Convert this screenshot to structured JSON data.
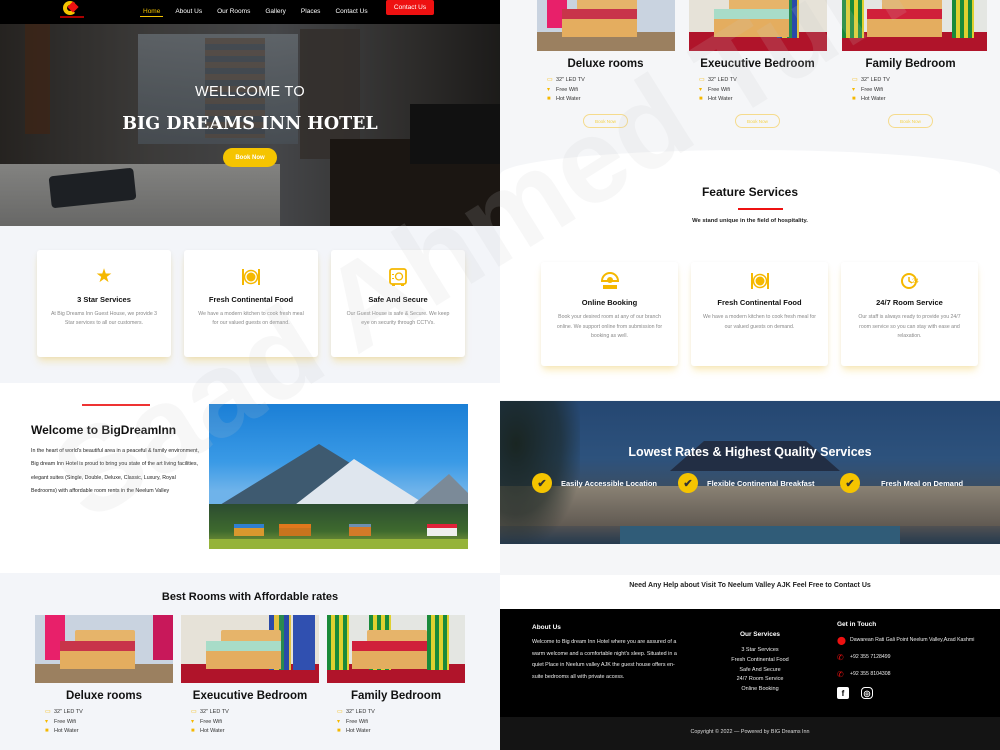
{
  "nav": {
    "links": [
      "Home",
      "About Us",
      "Our Rooms",
      "Gallery",
      "Places",
      "Contact Us"
    ],
    "active": "Home",
    "cta_label": "Contact Us"
  },
  "hero": {
    "welcome": "WELLCOME TO",
    "title": "BIG DREAMS INN HOTEL",
    "button": "Book Now"
  },
  "services": [
    {
      "icon": "star-icon",
      "title": "3 Star Services",
      "desc": "At Big Dreams Inn Guest House, we provide 3 Star services to all our customers."
    },
    {
      "icon": "plate-icon",
      "title": "Fresh Continental Food",
      "desc": "We have a modern kitchen to cook fresh meal for our valued guests on demand."
    },
    {
      "icon": "safe-icon",
      "title": "Safe And Secure",
      "desc": "Our Guest House is safe & Secure. We keep eye on security through CCTVs."
    }
  ],
  "welcome": {
    "title": "Welcome to BigDreamInn",
    "text": "In the heart of world's beautiful area in a peaceful & family environment, Big dream Inn Hotel is proud to bring you state of the art living facilities, elegant suites (Single, Double, Deluxe, Classic, Luxury, Royal Bedrooms) with affordable room rents in the Neelum Valley"
  },
  "rooms": {
    "title": "Best Rooms with Affordable rates",
    "items": [
      {
        "name": "Deluxe rooms",
        "features": [
          "32\" LED TV",
          "Free Wifi",
          "Hot Water"
        ],
        "button": "Book Now"
      },
      {
        "name": "Exeucutive Bedroom",
        "features": [
          "32\" LED TV",
          "Free Wifi",
          "Hot Water"
        ],
        "button": "Book Now"
      },
      {
        "name": "Family Bedroom",
        "features": [
          "32\" LED TV",
          "Free Wifi",
          "Hot Water"
        ],
        "button": "Book Now"
      }
    ]
  },
  "feature_services": {
    "title": "Feature Services",
    "subtitle": "We stand unique in the field of hospitality.",
    "items": [
      {
        "icon": "online-booking-icon",
        "title": "Online Booking",
        "desc": "Book your desired room at any of our branch online. We support online from submission for booking as well."
      },
      {
        "icon": "plate-icon",
        "title": "Fresh Continental Food",
        "desc": "We have a modern kitchen to cook fresh meal for our valued guests on demand."
      },
      {
        "icon": "clock-24-icon",
        "title": "24/7 Room Service",
        "desc": "Our staff is always ready to provide you 24/7 room service so you can stay with ease and relaxation."
      }
    ]
  },
  "lowest": {
    "title": "Lowest Rates & Highest Quality Services",
    "checks": [
      "Easily Accessible Location",
      "Flexible Continental Breakfast",
      "Fresh Meal on Demand"
    ]
  },
  "help": {
    "text": "Need Any Help about Visit To Neelum Valley AJK Feel Free to Contact Us"
  },
  "footer": {
    "about_title": "About Us",
    "about_text": "Welcome to Big dream Inn  Hotel where you are assured of a warm welcome and a comfortable night's sleep. Situated in a quiet Place in Neelum valley AJK the guest house offers  en-suite bedrooms all with private access.",
    "services_title": "Our Services",
    "services": [
      "3 Star Services",
      "Fresh Continental Food",
      "Safe And Secure",
      "24/7 Room Service",
      "Online Booking"
    ],
    "contact_title": "Get in Touch",
    "address": "Dawarean Rati Gali Point Neelum Valley,Azad Kashmi",
    "phone1": "+92 355 7128499",
    "phone2": "+92 355 8104308",
    "copyright": "Copyright © 2022 — Powered by BIG Dreams Inn"
  },
  "watermark": "Saad Ahmed Turk",
  "colors": {
    "accent": "#f5c400",
    "cta": "#ee1111",
    "footer_bg": "#000000"
  }
}
